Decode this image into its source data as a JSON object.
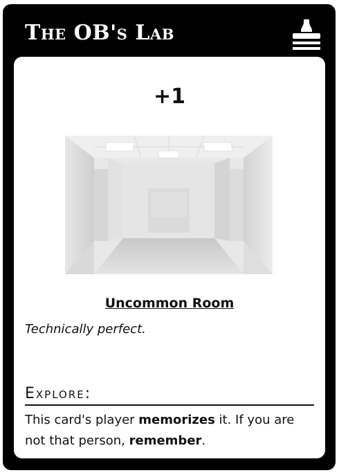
{
  "card": {
    "header_title": "The OB's Lab",
    "header_icon": "stamp-icon",
    "cost": "+1",
    "image_icon": "empty-white-room-image",
    "type": "Uncommon Room",
    "flavor": "Technically perfect.",
    "section_heading": "Explore:",
    "rules": {
      "part1": "This card's player ",
      "bold1": "memorizes",
      "part2": " it. If you are not that person, ",
      "bold2": "remember",
      "part3": "."
    }
  },
  "colors": {
    "frame": "#000000",
    "panel": "#ffffff",
    "text": "#111111"
  }
}
